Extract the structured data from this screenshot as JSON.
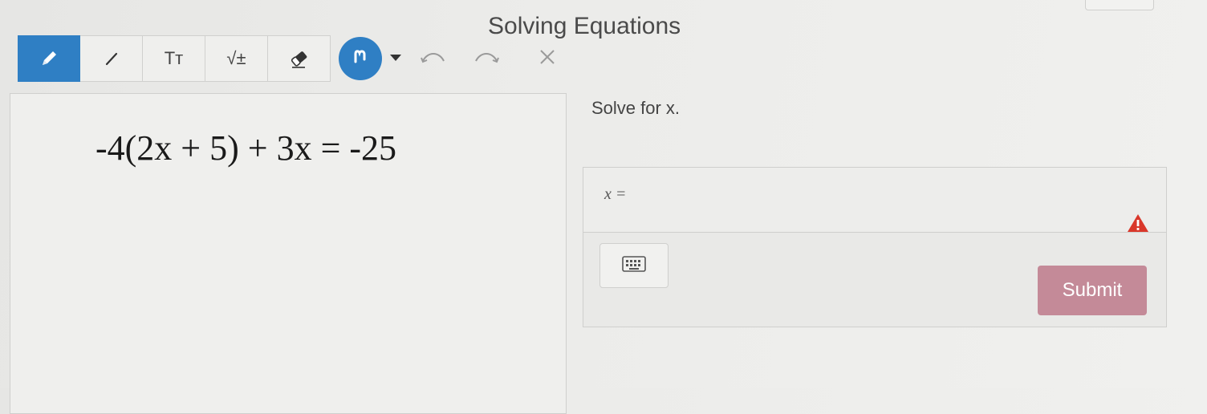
{
  "page": {
    "title": "Solving Equations"
  },
  "toolbar": {
    "tools": [
      {
        "icon": "pencil-icon",
        "active": true
      },
      {
        "icon": "line-icon",
        "active": false
      },
      {
        "icon": "text-icon",
        "label": "Tт",
        "active": false
      },
      {
        "icon": "math-icon",
        "label": "√±",
        "active": false
      },
      {
        "icon": "eraser-icon",
        "active": false
      }
    ],
    "color_icon": "ink-color-icon",
    "accent": "#2f7fc4"
  },
  "canvas": {
    "problem": "-4(2x + 5) + 3x = -25"
  },
  "question": {
    "prompt": "Solve for x."
  },
  "answer": {
    "variable_label": "x =",
    "value": "",
    "submit_label": "Submit",
    "submit_color": "#c48a98",
    "warning_color": "#d9372a"
  }
}
